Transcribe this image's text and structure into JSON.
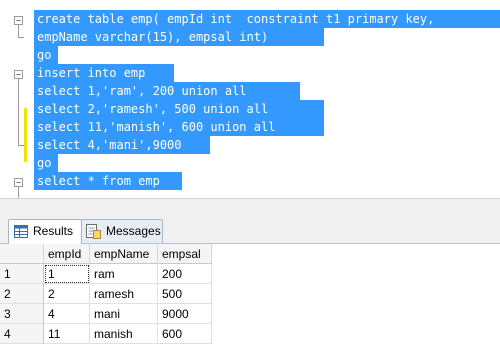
{
  "editor": {
    "lines": [
      "create table emp( empId int  constraint t1 primary key,",
      "empName varchar(15), empsal int)",
      "go",
      "insert into emp",
      "select 1,'ram', 200 union all",
      "select 2,'ramesh', 500 union all",
      "select 11,'manish', 600 union all",
      "select 4,'mani',9000",
      "go",
      "select * from emp"
    ],
    "collapse_symbol": "−",
    "selection_color": "#3399ff"
  },
  "tabs": [
    {
      "label": "Results",
      "icon": "grid-icon"
    },
    {
      "label": "Messages",
      "icon": "messages-icon"
    }
  ],
  "grid": {
    "columns": [
      "empId",
      "empName",
      "empsal"
    ],
    "rows": [
      {
        "num": "1",
        "cells": [
          "1",
          "ram",
          "200"
        ]
      },
      {
        "num": "2",
        "cells": [
          "2",
          "ramesh",
          "500"
        ]
      },
      {
        "num": "3",
        "cells": [
          "4",
          "mani",
          "9000"
        ]
      },
      {
        "num": "4",
        "cells": [
          "11",
          "manish",
          "600"
        ]
      }
    ]
  }
}
